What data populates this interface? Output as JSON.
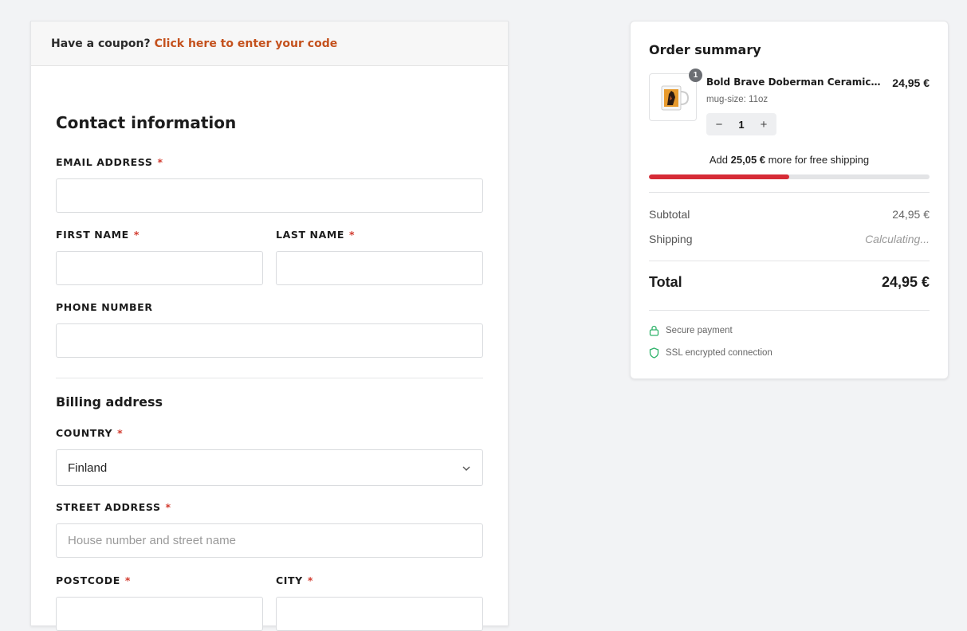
{
  "coupon": {
    "prompt": "Have a coupon?",
    "link": "Click here to enter your code"
  },
  "contact": {
    "title": "Contact information",
    "email_label": "EMAIL ADDRESS",
    "first_name_label": "FIRST NAME",
    "last_name_label": "LAST NAME",
    "phone_label": "PHONE NUMBER",
    "required_mark": "*"
  },
  "billing": {
    "title": "Billing address",
    "country_label": "COUNTRY",
    "country_value": "Finland",
    "street_label": "STREET ADDRESS",
    "street_placeholder": "House number and street name",
    "postcode_label": "POSTCODE",
    "city_label": "CITY"
  },
  "summary": {
    "title": "Order summary",
    "item": {
      "name": "Bold Brave Doberman Ceramic Mug",
      "price": "24,95 €",
      "variant": "mug-size: 11oz",
      "quantity": "1",
      "badge": "1"
    },
    "shipping_msg_pre": "Add",
    "shipping_msg_amount": "25,05 €",
    "shipping_msg_post": "more for free shipping",
    "shipping_progress": 0.5,
    "subtotal_label": "Subtotal",
    "subtotal_value": "24,95 €",
    "shipping_label": "Shipping",
    "shipping_value": "Calculating...",
    "total_label": "Total",
    "total_value": "24,95 €",
    "trust_secure": "Secure payment",
    "trust_ssl": "SSL encrypted connection"
  },
  "colors": {
    "accent": "#c4511d",
    "progress": "#d62b36",
    "trust_icon": "#2fb36a"
  },
  "icons": {
    "stepper_minus": "minus-icon",
    "stepper_plus": "plus-icon",
    "select": "chevron-down-icon",
    "secure": "lock-icon",
    "ssl": "shield-icon"
  }
}
